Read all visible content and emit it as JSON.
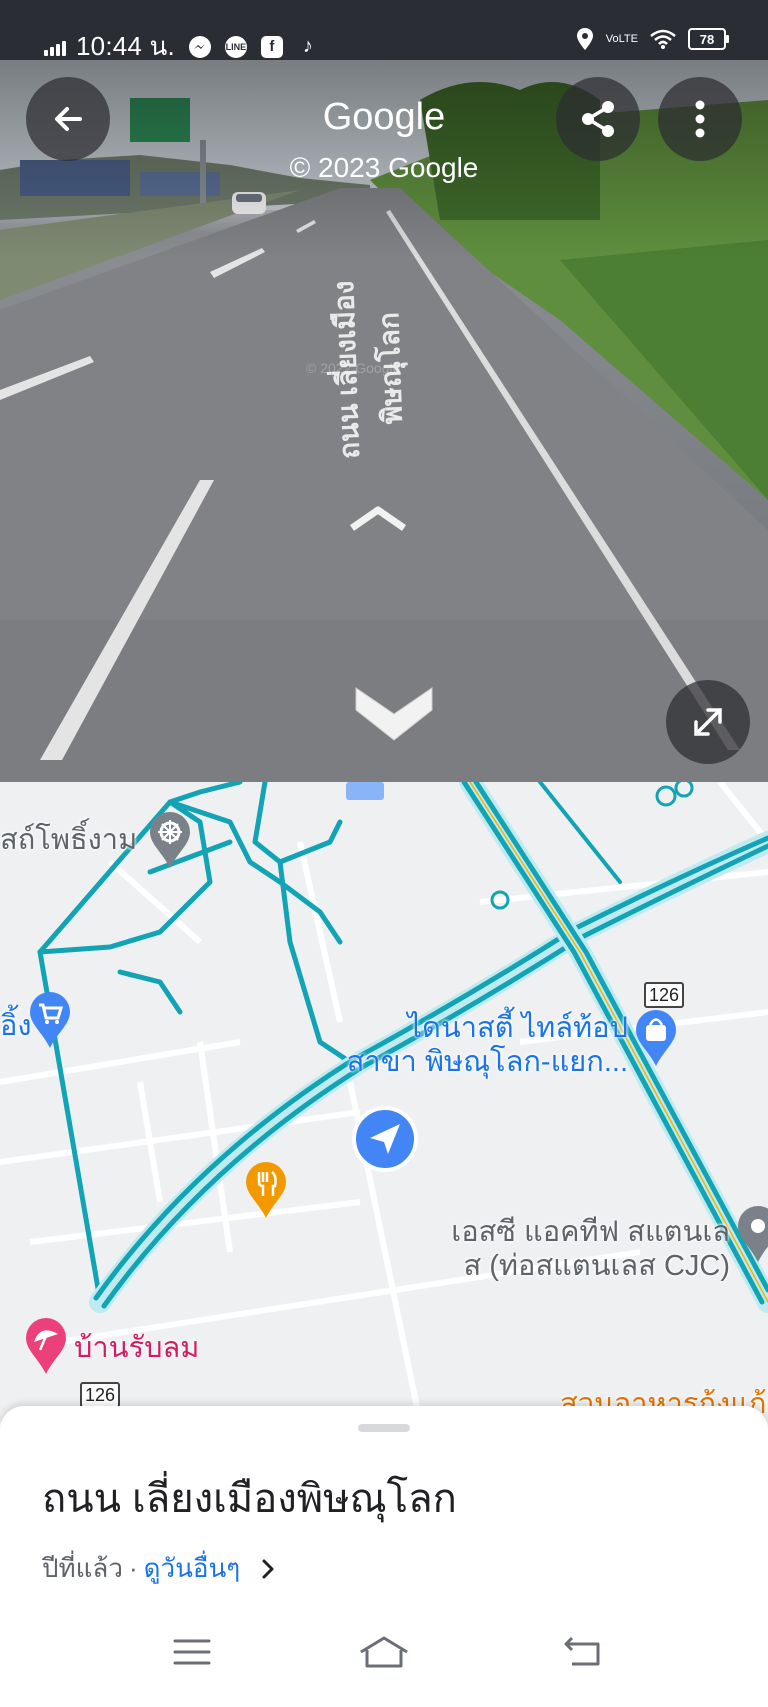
{
  "status_bar": {
    "time": "10:44 น.",
    "app_icons": [
      "messenger-icon",
      "line-icon",
      "facebook-icon",
      "tiktok-icon"
    ],
    "line_label": "LINE",
    "fb_label": "f",
    "tiktok_label": "♪",
    "network": "VoLTE",
    "battery": "78"
  },
  "street_view": {
    "title": "Google",
    "copyright": "© 2023 Google",
    "road_marking": "ถนน เลี่ยงเมืองพิษณุโลก",
    "watermark": "© 2022 Google"
  },
  "map": {
    "labels": {
      "temple": "สถ์โพธิ์งาม",
      "shop_left": "อิ้ง",
      "store_line1": "ไดนาสตี้ ไทล์ท้อป",
      "store_line2": "สาขา พิษณุโลก-แยก...",
      "sc_line1": "เอสซี แอคทีฟ สแตนเล",
      "sc_line2": "ส (ท่อสแตนเลส CJC)",
      "restaurant": "บ้านรับลม",
      "bottom_partial": "สวนอาหารกุ้งแก้ว"
    },
    "route_shields": [
      "126",
      "126"
    ]
  },
  "sheet": {
    "title": "ถนน เลี่ยงเมืองพิษณุโลก",
    "when": "ปีที่แล้ว",
    "separator": "·",
    "more_dates": "ดูวันอื่นๆ"
  },
  "colors": {
    "route_cyan": "#12a4b5",
    "accent_blue": "#1a73e8",
    "map_background": "#eef0f2"
  }
}
